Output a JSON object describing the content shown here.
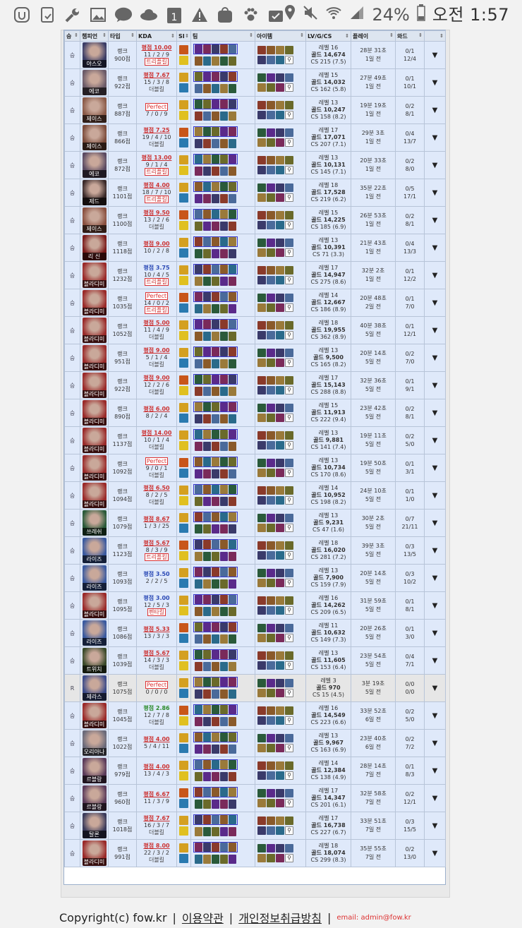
{
  "status_bar": {
    "icons": [
      "app-launcher-icon",
      "tablet-icon",
      "wrench-icon",
      "image-icon",
      "talk-icon",
      "cloud-icon",
      "calendar-icon",
      "warning-icon",
      "bag-icon",
      "paw-icon",
      "clipboard-check-icon"
    ],
    "talk_label": "TALK",
    "calendar_label": "1",
    "right_icons": [
      "location-icon",
      "mute-icon",
      "wifi-icon",
      "signal-icon",
      "battery-icon"
    ],
    "battery": "24%",
    "time": "오전 1:57"
  },
  "headers": {
    "result": "승",
    "champion": "챔피언",
    "type": "타입",
    "kda": "KDA",
    "spells": "SI",
    "team": "팀",
    "items": "아이템",
    "stats": "LV/G/CS",
    "play": "플레이",
    "ward": "와드"
  },
  "rows": [
    {
      "r": "승",
      "champ": "야스오",
      "cc": "#3b3d66",
      "type": "랭크",
      "lp": "900점",
      "grade": "평점 10.00",
      "gc": "red",
      "kda": "11 / 2 / 9",
      "multi": "트리플킬",
      "box": true,
      "lv": "레벨 16",
      "gold": "골드 14,674",
      "cs": "CS 215 (7.5)",
      "dur": "28분 31초",
      "ago": "1일 전",
      "w1": "0/1",
      "w2": "12/4"
    },
    {
      "r": "승",
      "champ": "에코",
      "cc": "#6a5a68",
      "type": "랭크",
      "lp": "922점",
      "grade": "평점 7.67",
      "gc": "red",
      "kda": "15 / 3 / 8",
      "multi": "더블킬",
      "box": false,
      "lv": "레벨 15",
      "gold": "골드 14,032",
      "cs": "CS 162 (5.8)",
      "dur": "27분 49초",
      "ago": "1일 전",
      "w1": "0/1",
      "w2": "10/1"
    },
    {
      "r": "승",
      "champ": "제이스",
      "cc": "#8a5a48",
      "type": "랭크",
      "lp": "887점",
      "grade": "Perfect",
      "gc": "perfect",
      "kda": "7 / 0 / 9",
      "multi": "",
      "box": false,
      "lv": "레벨 13",
      "gold": "골드 10,247",
      "cs": "CS 158 (8.2)",
      "dur": "19분 19초",
      "ago": "1일 전",
      "w1": "0/2",
      "w2": "8/1"
    },
    {
      "r": "승",
      "champ": "제이스",
      "cc": "#7a4a3a",
      "type": "랭크",
      "lp": "866점",
      "grade": "평점 7.25",
      "gc": "red",
      "kda": "19 / 4 / 10",
      "multi": "더블킬",
      "box": false,
      "lv": "레벨 17",
      "gold": "골드 17,071",
      "cs": "CS 207 (7.1)",
      "dur": "29분 3초",
      "ago": "1일 전",
      "w1": "0/4",
      "w2": "13/7"
    },
    {
      "r": "승",
      "champ": "에코",
      "cc": "#5a4a62",
      "type": "랭크",
      "lp": "872점",
      "grade": "평점 13.00",
      "gc": "red",
      "kda": "9 / 1 / 4",
      "multi": "트리플킬",
      "box": true,
      "lv": "레벨 13",
      "gold": "골드 10,131",
      "cs": "CS 145 (7.1)",
      "dur": "20분 33초",
      "ago": "1일 전",
      "w1": "0/2",
      "w2": "8/0"
    },
    {
      "r": "승",
      "champ": "제드",
      "cc": "#3a2a2a",
      "type": "랭크",
      "lp": "1101점",
      "grade": "평점 4.00",
      "gc": "red",
      "kda": "18 / 7 / 10",
      "multi": "트리플킬",
      "box": true,
      "lv": "레벨 18",
      "gold": "골드 17,528",
      "cs": "CS 219 (6.2)",
      "dur": "35분 22초",
      "ago": "1일 전",
      "w1": "0/5",
      "w2": "17/1"
    },
    {
      "r": "승",
      "champ": "제이스",
      "cc": "#8a5040",
      "type": "랭크",
      "lp": "1100점",
      "grade": "평점 9.50",
      "gc": "red",
      "kda": "13 / 2 / 6",
      "multi": "더블킬",
      "box": false,
      "lv": "레벨 15",
      "gold": "골드 14,225",
      "cs": "CS 185 (6.9)",
      "dur": "26분 53초",
      "ago": "1일 전",
      "w1": "0/2",
      "w2": "8/1"
    },
    {
      "r": "승",
      "champ": "리 신",
      "cc": "#7a1a1a",
      "type": "랭크",
      "lp": "1118점",
      "grade": "평점 9.00",
      "gc": "red",
      "kda": "10 / 2 / 8",
      "multi": "",
      "box": false,
      "lv": "레벨 13",
      "gold": "골드 10,391",
      "cs": "CS 71 (3.3)",
      "dur": "21분 43초",
      "ago": "1일 전",
      "w1": "0/4",
      "w2": "13/3"
    },
    {
      "r": "승",
      "champ": "블라디미",
      "cc": "#9a2a2a",
      "type": "랭크",
      "lp": "1232점",
      "grade": "평점 3.75",
      "gc": "blue",
      "kda": "10 / 4 / 5",
      "multi": "트리플킬",
      "box": true,
      "lv": "레벨 17",
      "gold": "골드 14,947",
      "cs": "CS 275 (8.6)",
      "dur": "32분 2초",
      "ago": "1일 전",
      "w1": "0/1",
      "w2": "12/2"
    },
    {
      "r": "승",
      "champ": "블라디미",
      "cc": "#9a2a2a",
      "type": "랭크",
      "lp": "1035점",
      "grade": "Perfect",
      "gc": "perfect",
      "kda": "14 / 0 / 2",
      "multi": "트리플킬",
      "box": true,
      "lv": "레벨 14",
      "gold": "골드 12,667",
      "cs": "CS 186 (8.9)",
      "dur": "20분 48초",
      "ago": "2일 전",
      "w1": "0/1",
      "w2": "7/0"
    },
    {
      "r": "승",
      "champ": "블라디미",
      "cc": "#9a2a2a",
      "type": "랭크",
      "lp": "1052점",
      "grade": "평점 5.00",
      "gc": "red",
      "kda": "11 / 4 / 9",
      "multi": "더블킬",
      "box": false,
      "lv": "레벨 18",
      "gold": "골드 19,955",
      "cs": "CS 362 (8.9)",
      "dur": "40분 38초",
      "ago": "5일 전",
      "w1": "0/1",
      "w2": "12/1"
    },
    {
      "r": "승",
      "champ": "블라디미",
      "cc": "#9a2a2a",
      "type": "랭크",
      "lp": "951점",
      "grade": "평점 9.00",
      "gc": "red",
      "kda": "5 / 1 / 4",
      "multi": "더블킬",
      "box": false,
      "lv": "레벨 13",
      "gold": "골드 9,500",
      "cs": "CS 165 (8.2)",
      "dur": "20분 14초",
      "ago": "5일 전",
      "w1": "0/2",
      "w2": "7/0"
    },
    {
      "r": "승",
      "champ": "블라디미",
      "cc": "#9a2a2a",
      "type": "랭크",
      "lp": "922점",
      "grade": "평점 9.00",
      "gc": "red",
      "kda": "12 / 2 / 6",
      "multi": "더블킬",
      "box": false,
      "lv": "레벨 17",
      "gold": "골드 15,143",
      "cs": "CS 288 (8.8)",
      "dur": "32분 36초",
      "ago": "5일 전",
      "w1": "0/1",
      "w2": "9/1"
    },
    {
      "r": "승",
      "champ": "블라디미",
      "cc": "#9a2a2a",
      "type": "랭크",
      "lp": "890점",
      "grade": "평점 6.00",
      "gc": "red",
      "kda": "8 / 2 / 4",
      "multi": "",
      "box": false,
      "lv": "레벨 15",
      "gold": "골드 11,913",
      "cs": "CS 222 (9.4)",
      "dur": "23분 42초",
      "ago": "5일 전",
      "w1": "0/2",
      "w2": "8/1"
    },
    {
      "r": "승",
      "champ": "블라디미",
      "cc": "#9a2a2a",
      "type": "랭크",
      "lp": "1137점",
      "grade": "평점 14.00",
      "gc": "red",
      "kda": "10 / 1 / 4",
      "multi": "더블킬",
      "box": false,
      "lv": "레벨 13",
      "gold": "골드 9,881",
      "cs": "CS 141 (7.4)",
      "dur": "19분 11초",
      "ago": "5일 전",
      "w1": "0/2",
      "w2": "5/0"
    },
    {
      "r": "승",
      "champ": "블라디미",
      "cc": "#9a2a2a",
      "type": "랭크",
      "lp": "1092점",
      "grade": "Perfect",
      "gc": "perfect",
      "kda": "9 / 0 / 1",
      "multi": "더블킬",
      "box": false,
      "lv": "레벨 13",
      "gold": "골드 10,734",
      "cs": "CS 170 (8.6)",
      "dur": "19분 50초",
      "ago": "5일 전",
      "w1": "0/1",
      "w2": "3/1"
    },
    {
      "r": "승",
      "champ": "블라디미",
      "cc": "#9a2a2a",
      "type": "랭크",
      "lp": "1094점",
      "grade": "평점 6.50",
      "gc": "red",
      "kda": "8 / 2 / 5",
      "multi": "더블킬",
      "box": false,
      "lv": "레벨 14",
      "gold": "골드 10,952",
      "cs": "CS 198 (8.2)",
      "dur": "24분 10초",
      "ago": "5일 전",
      "w1": "0/1",
      "w2": "1/0"
    },
    {
      "r": "승",
      "champ": "쓰레쉬",
      "cc": "#2a5a3a",
      "type": "랭크",
      "lp": "1079점",
      "grade": "평점 8.67",
      "gc": "red",
      "kda": "1 / 3 / 25",
      "multi": "",
      "box": false,
      "lv": "레벨 13",
      "gold": "골드 9,231",
      "cs": "CS 47 (1.6)",
      "dur": "30분 2초",
      "ago": "5일 전",
      "w1": "0/7",
      "w2": "21/11"
    },
    {
      "r": "승",
      "champ": "라이즈",
      "cc": "#3a5aa0",
      "type": "랭크",
      "lp": "1123점",
      "grade": "평점 5.67",
      "gc": "red",
      "kda": "8 / 3 / 9",
      "multi": "트리플킬",
      "box": true,
      "lv": "레벨 18",
      "gold": "골드 16,020",
      "cs": "CS 281 (7.2)",
      "dur": "39분 3초",
      "ago": "5일 전",
      "w1": "0/3",
      "w2": "13/5"
    },
    {
      "r": "승",
      "champ": "라이즈",
      "cc": "#3a5aa0",
      "type": "랭크",
      "lp": "1093점",
      "grade": "평점 3.50",
      "gc": "blue",
      "kda": "2 / 2 / 5",
      "multi": "",
      "box": false,
      "lv": "레벨 13",
      "gold": "골드 7,900",
      "cs": "CS 159 (7.9)",
      "dur": "20분 14초",
      "ago": "5일 전",
      "w1": "0/3",
      "w2": "10/2"
    },
    {
      "r": "승",
      "champ": "블라디미",
      "cc": "#9a2a2a",
      "type": "랭크",
      "lp": "1095점",
      "grade": "평점 3.00",
      "gc": "blue",
      "kda": "12 / 5 / 3",
      "multi": "펜타킬",
      "box": true,
      "lv": "레벨 16",
      "gold": "골드 14,262",
      "cs": "CS 209 (6.5)",
      "dur": "31분 59초",
      "ago": "5일 전",
      "w1": "0/1",
      "w2": "8/1"
    },
    {
      "r": "승",
      "champ": "라이즈",
      "cc": "#3a5aa0",
      "type": "랭크",
      "lp": "1086점",
      "grade": "평점 5.33",
      "gc": "red",
      "kda": "13 / 3 / 3",
      "multi": "",
      "box": false,
      "lv": "레벨 11",
      "gold": "골드 10,632",
      "cs": "CS 149 (7.3)",
      "dur": "20분 26초",
      "ago": "5일 전",
      "w1": "0/1",
      "w2": "3/0"
    },
    {
      "r": "승",
      "champ": "트위치",
      "cc": "#3a4a2a",
      "type": "랭크",
      "lp": "1039점",
      "grade": "평점 5.67",
      "gc": "red",
      "kda": "14 / 3 / 3",
      "multi": "더블킬",
      "box": false,
      "lv": "레벨 13",
      "gold": "골드 11,605",
      "cs": "CS 153 (6.4)",
      "dur": "23분 54초",
      "ago": "5일 전",
      "w1": "0/4",
      "w2": "7/1"
    },
    {
      "r": "R",
      "champ": "제라스",
      "cc": "#3a4a8a",
      "type": "랭크",
      "lp": "1075점",
      "grade": "Perfect",
      "gc": "perfect",
      "kda": "0 / 0 / 0",
      "multi": "",
      "box": false,
      "lv": "레벨 3",
      "gold": "골드 970",
      "cs": "CS 15 (4.5)",
      "dur": "3분 19초",
      "ago": "5일 전",
      "w1": "0/0",
      "w2": "0/0",
      "remake": true
    },
    {
      "r": "승",
      "champ": "블라디미",
      "cc": "#9a2a2a",
      "type": "랭크",
      "lp": "1045점",
      "grade": "평점 2.86",
      "gc": "green",
      "kda": "12 / 7 / 8",
      "multi": "더블킬",
      "box": false,
      "lv": "레벨 16",
      "gold": "골드 14,549",
      "cs": "CS 223 (6.6)",
      "dur": "33분 52초",
      "ago": "6일 전",
      "w1": "0/2",
      "w2": "5/0"
    },
    {
      "r": "승",
      "champ": "오리아나",
      "cc": "#6a6a7a",
      "type": "랭크",
      "lp": "1022점",
      "grade": "평점 4.00",
      "gc": "red",
      "kda": "5 / 4 / 11",
      "multi": "",
      "box": false,
      "lv": "레벨 13",
      "gold": "골드 9,967",
      "cs": "CS 163 (6.9)",
      "dur": "23분 40초",
      "ago": "6일 전",
      "w1": "0/2",
      "w2": "7/2"
    },
    {
      "r": "승",
      "champ": "르블랑",
      "cc": "#5a3a5a",
      "type": "랭크",
      "lp": "979점",
      "grade": "평점 4.00",
      "gc": "red",
      "kda": "13 / 4 / 3",
      "multi": "",
      "box": false,
      "lv": "레벨 14",
      "gold": "골드 12,384",
      "cs": "CS 138 (4.9)",
      "dur": "28분 14초",
      "ago": "7일 전",
      "w1": "0/1",
      "w2": "8/3"
    },
    {
      "r": "승",
      "champ": "르블랑",
      "cc": "#5a3a5a",
      "type": "랭크",
      "lp": "960점",
      "grade": "평점 6.67",
      "gc": "red",
      "kda": "11 / 3 / 9",
      "multi": "",
      "box": false,
      "lv": "레벨 17",
      "gold": "골드 14,347",
      "cs": "CS 201 (6.1)",
      "dur": "32분 58초",
      "ago": "7일 전",
      "w1": "0/2",
      "w2": "12/1"
    },
    {
      "r": "승",
      "champ": "탈론",
      "cc": "#3a3a5a",
      "type": "랭크",
      "lp": "1018점",
      "grade": "평점 7.67",
      "gc": "red",
      "kda": "16 / 3 / 7",
      "multi": "더블킬",
      "box": false,
      "lv": "레벨 17",
      "gold": "골드 16,738",
      "cs": "CS 227 (6.7)",
      "dur": "33분 51초",
      "ago": "7일 전",
      "w1": "0/3",
      "w2": "15/5"
    },
    {
      "r": "승",
      "champ": "블라디미",
      "cc": "#9a2a2a",
      "type": "랭크",
      "lp": "991점",
      "grade": "평점 8.00",
      "gc": "red",
      "kda": "22 / 3 / 2",
      "multi": "더블킬",
      "box": false,
      "lv": "레벨 18",
      "gold": "골드 18,074",
      "cs": "CS 299 (8.3)",
      "dur": "35분 55초",
      "ago": "7일 전",
      "w1": "0/2",
      "w2": "13/0"
    }
  ],
  "palette": [
    "#5a2a8a",
    "#8a3a2a",
    "#2a6a8a",
    "#6a6a2a",
    "#3a3a6a",
    "#8a5a2a",
    "#2a5a3a",
    "#7a2a5a",
    "#4a6a9a",
    "#9a7a3a"
  ],
  "footer": {
    "copyright": "Copyright(c) fow.kr",
    "sep": "|",
    "terms": "이용약관",
    "privacy": "개인정보취급방침",
    "email": "email: admin@fow.kr"
  }
}
